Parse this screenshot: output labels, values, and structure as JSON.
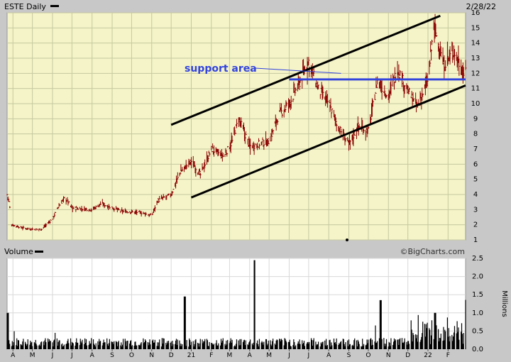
{
  "header": {
    "symbol_label": "ESTE Daily",
    "date": "2/28/22"
  },
  "volume_label": "Volume",
  "credit": "©BigCharts.com",
  "annotation": "support area",
  "colors": {
    "panel_bg": "#f4f4c8",
    "grid": "#c8c8a0",
    "frame": "#c8c8c8",
    "price_bar": "#8b0000",
    "volume_bar": "#000000",
    "channel_line": "#000000",
    "support_line": "#3344dd",
    "annotation_text": "#3344dd"
  },
  "chart_data": [
    {
      "type": "ohlc",
      "title": "ESTE Daily",
      "x_ticks": [
        "A",
        "M",
        "J",
        "J",
        "A",
        "S",
        "O",
        "N",
        "D",
        "21",
        "F",
        "M",
        "A",
        "M",
        "J",
        "J",
        "A",
        "S",
        "O",
        "N",
        "D",
        "22",
        "F"
      ],
      "y_ticks": [
        1,
        2,
        3,
        4,
        5,
        6,
        7,
        8,
        9,
        10,
        11,
        12,
        13,
        14,
        15,
        16
      ],
      "ylim": [
        1,
        16
      ],
      "grid": true,
      "approx_close_path": [
        {
          "x": "2020-03-23",
          "y": 4.0
        },
        {
          "x": "2020-03-26",
          "y": 3.5
        },
        {
          "x": "2020-03-30",
          "y": 2.0
        },
        {
          "x": "2020-04-15",
          "y": 1.8
        },
        {
          "x": "2020-05-01",
          "y": 1.7
        },
        {
          "x": "2020-05-15",
          "y": 1.7
        },
        {
          "x": "2020-06-01",
          "y": 2.4
        },
        {
          "x": "2020-06-10",
          "y": 3.2
        },
        {
          "x": "2020-06-20",
          "y": 3.8
        },
        {
          "x": "2020-07-01",
          "y": 3.1
        },
        {
          "x": "2020-08-01",
          "y": 3.0
        },
        {
          "x": "2020-08-15",
          "y": 3.4
        },
        {
          "x": "2020-09-15",
          "y": 2.9
        },
        {
          "x": "2020-10-15",
          "y": 2.8
        },
        {
          "x": "2020-11-01",
          "y": 2.6
        },
        {
          "x": "2020-11-10",
          "y": 3.6
        },
        {
          "x": "2020-12-01",
          "y": 4.0
        },
        {
          "x": "2020-12-15",
          "y": 5.5
        },
        {
          "x": "2021-01-01",
          "y": 6.2
        },
        {
          "x": "2021-01-15",
          "y": 5.3
        },
        {
          "x": "2021-02-01",
          "y": 7.0
        },
        {
          "x": "2021-02-20",
          "y": 6.5
        },
        {
          "x": "2021-03-05",
          "y": 7.5
        },
        {
          "x": "2021-03-15",
          "y": 9.0
        },
        {
          "x": "2021-04-01",
          "y": 7.2
        },
        {
          "x": "2021-05-01",
          "y": 7.5
        },
        {
          "x": "2021-05-15",
          "y": 9.2
        },
        {
          "x": "2021-06-01",
          "y": 10.0
        },
        {
          "x": "2021-06-15",
          "y": 11.2
        },
        {
          "x": "2021-07-01",
          "y": 12.8
        },
        {
          "x": "2021-07-15",
          "y": 11.0
        },
        {
          "x": "2021-08-01",
          "y": 10.0
        },
        {
          "x": "2021-08-15",
          "y": 8.5
        },
        {
          "x": "2021-09-01",
          "y": 7.3
        },
        {
          "x": "2021-09-15",
          "y": 8.5
        },
        {
          "x": "2021-10-01",
          "y": 8.2
        },
        {
          "x": "2021-10-15",
          "y": 11.5
        },
        {
          "x": "2021-11-01",
          "y": 10.5
        },
        {
          "x": "2021-11-15",
          "y": 12.3
        },
        {
          "x": "2021-12-01",
          "y": 10.8
        },
        {
          "x": "2021-12-15",
          "y": 9.8
        },
        {
          "x": "2022-01-01",
          "y": 11.5
        },
        {
          "x": "2022-01-10",
          "y": 15.2
        },
        {
          "x": "2022-01-25",
          "y": 12.5
        },
        {
          "x": "2022-02-10",
          "y": 13.5
        },
        {
          "x": "2022-02-25",
          "y": 12.0
        }
      ],
      "annotations": [
        {
          "kind": "channel_upper",
          "from": {
            "x": "2020-12-01",
            "y": 8.6
          },
          "to": {
            "x": "2022-01-20",
            "y": 15.8
          }
        },
        {
          "kind": "channel_lower",
          "from": {
            "x": "2021-01-01",
            "y": 3.8
          },
          "to": {
            "x": "2022-02-28",
            "y": 11.2
          }
        },
        {
          "kind": "support",
          "y": 11.6,
          "from": "2021-06-01",
          "to": "2022-02-28"
        },
        {
          "kind": "pointer",
          "text": "support area",
          "to": {
            "x": "2021-08-20",
            "y": 12.0
          }
        }
      ]
    },
    {
      "type": "bar",
      "title": "Volume",
      "unit_label": "Millions",
      "y_ticks": [
        0.0,
        0.5,
        1.0,
        1.5,
        2.0,
        2.5
      ],
      "ylim": [
        0,
        2.5
      ],
      "grid": true,
      "notable_spikes": [
        {
          "x": "2020-03-24",
          "value": 1.0
        },
        {
          "x": "2020-12-22",
          "value": 1.45
        },
        {
          "x": "2021-04-09",
          "value": 2.45
        },
        {
          "x": "2021-10-20",
          "value": 1.35
        },
        {
          "x": "2022-01-12",
          "value": 1.0
        }
      ],
      "typical_value": 0.2
    }
  ]
}
